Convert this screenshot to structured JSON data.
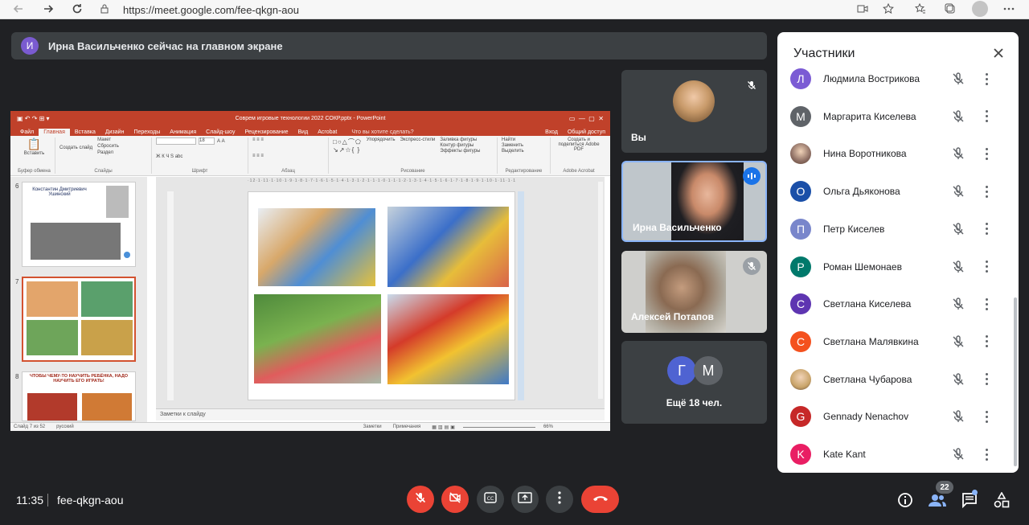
{
  "browser": {
    "url": "https://meet.google.com/fee-qkgn-aou"
  },
  "banner": {
    "avatar_letter": "И",
    "text": "Ирна Васильченко сейчас на главном экране"
  },
  "presentation": {
    "window_title": "Соврем игровые технологии 2022 СОКР.pptx - PowerPoint",
    "tabs": [
      "Файл",
      "Главная",
      "Вставка",
      "Дизайн",
      "Переходы",
      "Анимация",
      "Слайд-шоу",
      "Рецензирование",
      "Вид",
      "Acrobat"
    ],
    "active_tab": "Главная",
    "search_hint": "Что вы хотите сделать?",
    "login": "Вход",
    "share": "Общий доступ",
    "ribbon_groups": [
      {
        "items": [
          "Вставить"
        ],
        "label": "Буфер обмена"
      },
      {
        "items": [
          "Макет",
          "Сбросить",
          "Создать слайд",
          "Раздел"
        ],
        "label": "Слайды"
      },
      {
        "items": [
          "18",
          "А А",
          "Ж К Ч S abc"
        ],
        "label": "Шрифт"
      },
      {
        "items": [
          "≡ ≡ ≡"
        ],
        "label": "Абзац"
      },
      {
        "items": [
          "Упорядочить",
          "Экспресс-стили",
          "Заливка фигуры",
          "Контур фигуры",
          "Эффекты фигуры"
        ],
        "label": "Рисование"
      },
      {
        "items": [
          "Найти",
          "Заменить",
          "Выделить"
        ],
        "label": "Редактирование"
      },
      {
        "items": [
          "Создать и поделиться Adobe PDF"
        ],
        "label": "Adobe Acrobat"
      }
    ],
    "thumbnails": [
      {
        "num": "6",
        "title": "Константин Дмитриевич Ушинский"
      },
      {
        "num": "7",
        "title": ""
      },
      {
        "num": "8",
        "title": "ЧТОБЫ ЧЕМУ-ТО НАУЧИТЬ РЕБЁНКА, НАДО НАУЧИТЬ ЕГО ИГРАТЬ!"
      }
    ],
    "notes_placeholder": "Заметки к слайду",
    "status_left": "Слайд 7 из 52",
    "status_lang": "русский",
    "status_notes": "Заметки",
    "status_comments": "Примечания",
    "zoom": "66%"
  },
  "tiles": [
    {
      "name": "Вы"
    },
    {
      "name": "Ирна Васильченко"
    },
    {
      "name": "Алексей Потапов"
    },
    {
      "name": "Ещё 18 чел.",
      "avatars": [
        "Г",
        "М"
      ]
    }
  ],
  "participants_panel": {
    "title": "Участники",
    "people": [
      {
        "initial": "Л",
        "name": "Людмила Вострикова",
        "color": "#7b5bd4"
      },
      {
        "initial": "М",
        "name": "Маргарита Киселева",
        "color": "#5f6368"
      },
      {
        "initial": "",
        "name": "Нина Воротникова",
        "color": "#8d6e63"
      },
      {
        "initial": "О",
        "name": "Ольга Дьяконова",
        "color": "#1a4fa8"
      },
      {
        "initial": "П",
        "name": "Петр Киселев",
        "color": "#7986cb"
      },
      {
        "initial": "Р",
        "name": "Роман Шемонаев",
        "color": "#00796b"
      },
      {
        "initial": "С",
        "name": "Светлана Киселева",
        "color": "#5e35b1"
      },
      {
        "initial": "С",
        "name": "Светлана Малявкина",
        "color": "#f4511e"
      },
      {
        "initial": "",
        "name": "Светлана Чубарова",
        "color": "#c9a46a"
      },
      {
        "initial": "G",
        "name": "Gennady Nenachov",
        "color": "#c62828"
      },
      {
        "initial": "K",
        "name": "Kate Kant",
        "color": "#e91e63"
      }
    ]
  },
  "bottom": {
    "time": "11:35",
    "meeting_code": "fee-qkgn-aou",
    "participant_count": "22"
  },
  "colors": {
    "accent_red": "#ea4335",
    "meet_bg": "#202124",
    "tile_bg": "#3c4043",
    "active_speaker": "#8ab4f8"
  }
}
